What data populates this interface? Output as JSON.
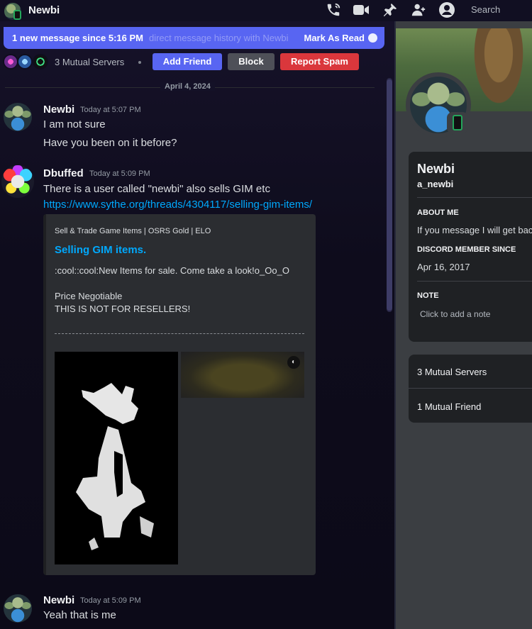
{
  "header": {
    "title": "Newbi",
    "search_placeholder": "Search",
    "icons": [
      "voice-call-icon",
      "video-call-icon",
      "pin-icon",
      "add-friend-icon",
      "user-profile-icon"
    ]
  },
  "banner": {
    "text": "1 new message since 5:16 PM",
    "ghost_text": "direct message history with Newbi",
    "action": "Mark As Read"
  },
  "mutual": {
    "label": "3 Mutual Servers",
    "add_friend": "Add Friend",
    "block": "Block",
    "report": "Report Spam"
  },
  "date_divider": "April 4, 2024",
  "messages": [
    {
      "author": "Newbi",
      "timestamp": "Today at 5:07 PM",
      "lines": [
        "I am not sure",
        "Have you been on it before?"
      ]
    },
    {
      "author": "Dbuffed",
      "timestamp": "Today at 5:09 PM",
      "lines": [
        "There is a user called \"newbi\" also sells GIM etc"
      ],
      "link": "https://www.sythe.org/threads/4304117/selling-gim-items/",
      "embed": {
        "provider": "Sell & Trade Game Items | OSRS Gold | ELO",
        "title": "Selling GIM items.",
        "desc1": ":cool::cool:New Items for sale. Come take a look!o_Oo_O",
        "desc2": "Price Negotiable",
        "desc3": "THIS IS NOT FOR RESELLERS!"
      }
    },
    {
      "author": "Newbi",
      "timestamp": "Today at 5:09 PM",
      "lines": [
        "Yeah that is me"
      ]
    }
  ],
  "profile": {
    "display_name": "Newbi",
    "username": "a_newbi",
    "about_header": "ABOUT ME",
    "about_text": "If you message I will get back",
    "member_header": "DISCORD MEMBER SINCE",
    "member_since": "Apr 16, 2017",
    "note_header": "NOTE",
    "note_placeholder": "Click to add a note",
    "mutual_servers": "3 Mutual Servers",
    "mutual_friends": "1 Mutual Friend"
  },
  "colors": {
    "accent": "#5865f2",
    "danger": "#da373c",
    "link": "#00a8fc",
    "online": "#23a55a"
  }
}
